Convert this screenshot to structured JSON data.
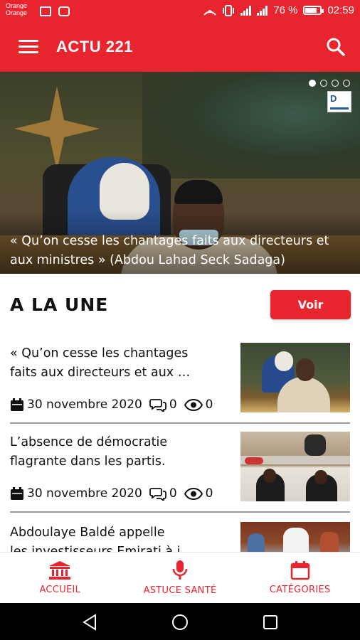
{
  "status_bar": {
    "carrier_line1": "Orange",
    "carrier_line2": "Orange",
    "battery": "76 %",
    "time": "02:59"
  },
  "app_bar": {
    "title": "ACTU 221",
    "menu_icon": "menu-icon",
    "search_icon": "search-icon"
  },
  "hero": {
    "caption": "« Qu’on cesse les chantages faits aux directeurs et aux ministres » (Abdou Lahad Seck Sadaga)",
    "slides": 4,
    "active_slide": 0,
    "logo_text": "D"
  },
  "section": {
    "title": "A LA UNE",
    "button_label": "Voir"
  },
  "articles": [
    {
      "title_line1": "« Qu’on cesse les chantages",
      "title_line2": "faits aux directeurs et aux …",
      "date": "30 novembre 2020",
      "comments": "0",
      "views": "0"
    },
    {
      "title_line1": "L’absence de démocratie",
      "title_line2": "flagrante dans les partis.",
      "date": "30 novembre 2020",
      "comments": "0",
      "views": "0"
    },
    {
      "title_line1": "Abdoulaye Baldé appelle",
      "title_line2": "les investisseurs Emirati à i…"
    }
  ],
  "bottom_nav": [
    {
      "label": "ACCUEIL",
      "icon": "bank-icon"
    },
    {
      "label": "ASTUCE SANTÉ",
      "icon": "microphone-icon"
    },
    {
      "label": "CATÉGORIES",
      "icon": "calendar-icon"
    }
  ],
  "colors": {
    "accent": "#e8242f",
    "text": "#111111",
    "background": "#ffffff"
  }
}
